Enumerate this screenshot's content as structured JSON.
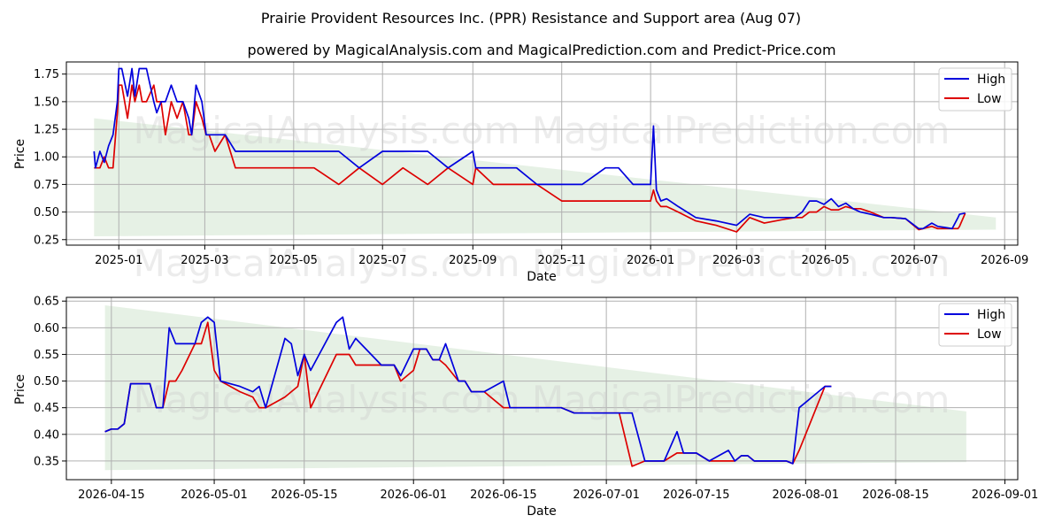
{
  "title": "Prairie Provident Resources Inc. (PPR) Resistance and Support area (Aug 07)",
  "subtitle": "powered by MagicalAnalysis.com and MagicalPrediction.com and Predict-Price.com",
  "watermark": "MagicalAnalysis.com    MagicalPrediction.com",
  "colors": {
    "high": "#0000dd",
    "low": "#dd0000",
    "band": "#e2efe0",
    "grid": "#b0b0b0"
  },
  "chart_data": [
    {
      "type": "line",
      "xlabel": "Date",
      "ylabel": "Price",
      "grid": true,
      "legend_position": "top-right",
      "xlim": [
        "2024-11-26",
        "2026-09-10"
      ],
      "ylim": [
        0.2,
        1.86
      ],
      "xticks": [
        "2025-01",
        "2025-03",
        "2025-05",
        "2025-07",
        "2025-09",
        "2025-11",
        "2026-01",
        "2026-03",
        "2026-05",
        "2026-07",
        "2026-09"
      ],
      "yticks": [
        "0.25",
        "0.50",
        "0.75",
        "1.00",
        "1.25",
        "1.50",
        "1.75"
      ],
      "band": {
        "label": "Resistance and Support area",
        "x": [
          "2024-12-15",
          "2026-08-26"
        ],
        "upper": [
          1.35,
          0.45
        ],
        "lower": [
          0.28,
          0.34
        ]
      },
      "series": [
        {
          "name": "High",
          "x": [
            "2024-12-15",
            "2024-12-16",
            "2024-12-19",
            "2024-12-22",
            "2024-12-25",
            "2024-12-28",
            "2024-12-31",
            "2025-01-01",
            "2025-01-03",
            "2025-01-07",
            "2025-01-10",
            "2025-01-12",
            "2025-01-15",
            "2025-01-17",
            "2025-01-20",
            "2025-01-25",
            "2025-01-27",
            "2025-01-30",
            "2025-02-02",
            "2025-02-06",
            "2025-02-10",
            "2025-02-14",
            "2025-02-18",
            "2025-02-20",
            "2025-02-23",
            "2025-02-27",
            "2025-03-02",
            "2025-03-04",
            "2025-03-08",
            "2025-03-15",
            "2025-03-22",
            "2025-03-27",
            "2025-04-01",
            "2025-04-15",
            "2025-05-01",
            "2025-05-10",
            "2025-05-15",
            "2025-06-01",
            "2025-06-15",
            "2025-07-01",
            "2025-07-15",
            "2025-08-01",
            "2025-08-15",
            "2025-09-01",
            "2025-09-03",
            "2025-09-15",
            "2025-10-01",
            "2025-10-15",
            "2025-11-01",
            "2025-11-15",
            "2025-12-01",
            "2025-12-10",
            "2025-12-20",
            "2026-01-01",
            "2026-01-03",
            "2026-01-05",
            "2026-01-08",
            "2026-01-12",
            "2026-01-20",
            "2026-02-01",
            "2026-02-15",
            "2026-03-01",
            "2026-03-10",
            "2026-03-20",
            "2026-04-01",
            "2026-04-10",
            "2026-04-15",
            "2026-04-20",
            "2026-04-25",
            "2026-04-30",
            "2026-05-05",
            "2026-05-10",
            "2026-05-15",
            "2026-05-20",
            "2026-05-25",
            "2026-06-01",
            "2026-06-10",
            "2026-06-15",
            "2026-06-25",
            "2026-07-04",
            "2026-07-07",
            "2026-07-13",
            "2026-07-17",
            "2026-07-22",
            "2026-07-27",
            "2026-07-31",
            "2026-08-01",
            "2026-08-05"
          ],
          "values": [
            1.05,
            0.9,
            1.05,
            0.95,
            1.1,
            1.2,
            1.5,
            1.8,
            1.8,
            1.55,
            1.8,
            1.55,
            1.8,
            1.8,
            1.8,
            1.5,
            1.4,
            1.5,
            1.5,
            1.65,
            1.5,
            1.5,
            1.35,
            1.2,
            1.65,
            1.5,
            1.2,
            1.2,
            1.2,
            1.2,
            1.05,
            1.05,
            1.05,
            1.05,
            1.05,
            1.05,
            1.05,
            1.05,
            0.9,
            1.05,
            1.05,
            1.05,
            0.9,
            1.05,
            0.9,
            0.9,
            0.9,
            0.75,
            0.75,
            0.75,
            0.9,
            0.9,
            0.75,
            0.75,
            1.28,
            0.7,
            0.6,
            0.62,
            0.55,
            0.45,
            0.42,
            0.38,
            0.48,
            0.45,
            0.45,
            0.45,
            0.5,
            0.6,
            0.6,
            0.57,
            0.62,
            0.55,
            0.58,
            0.53,
            0.5,
            0.48,
            0.45,
            0.45,
            0.44,
            0.35,
            0.35,
            0.4,
            0.37,
            0.36,
            0.35,
            0.45,
            0.48,
            0.49
          ]
        },
        {
          "name": "Low",
          "x": [
            "2024-12-15",
            "2024-12-19",
            "2024-12-22",
            "2024-12-25",
            "2024-12-28",
            "2024-12-31",
            "2025-01-01",
            "2025-01-03",
            "2025-01-07",
            "2025-01-10",
            "2025-01-12",
            "2025-01-15",
            "2025-01-17",
            "2025-01-20",
            "2025-01-25",
            "2025-01-27",
            "2025-01-30",
            "2025-02-02",
            "2025-02-06",
            "2025-02-10",
            "2025-02-14",
            "2025-02-18",
            "2025-02-20",
            "2025-02-23",
            "2025-02-27",
            "2025-03-02",
            "2025-03-04",
            "2025-03-08",
            "2025-03-15",
            "2025-03-22",
            "2025-03-27",
            "2025-04-01",
            "2025-04-15",
            "2025-05-01",
            "2025-05-10",
            "2025-05-15",
            "2025-06-01",
            "2025-06-15",
            "2025-07-01",
            "2025-07-15",
            "2025-08-01",
            "2025-08-15",
            "2025-09-01",
            "2025-09-03",
            "2025-09-15",
            "2025-10-01",
            "2025-10-15",
            "2025-11-01",
            "2025-11-15",
            "2025-12-01",
            "2025-12-10",
            "2025-12-20",
            "2026-01-01",
            "2026-01-03",
            "2026-01-05",
            "2026-01-08",
            "2026-01-12",
            "2026-01-20",
            "2026-02-01",
            "2026-02-15",
            "2026-03-01",
            "2026-03-10",
            "2026-03-20",
            "2026-04-01",
            "2026-04-10",
            "2026-04-15",
            "2026-04-20",
            "2026-04-25",
            "2026-04-30",
            "2026-05-05",
            "2026-05-10",
            "2026-05-15",
            "2026-05-20",
            "2026-05-25",
            "2026-06-01",
            "2026-06-10",
            "2026-06-15",
            "2026-06-25",
            "2026-07-04",
            "2026-07-07",
            "2026-07-13",
            "2026-07-17",
            "2026-07-22",
            "2026-07-27",
            "2026-07-31",
            "2026-08-01",
            "2026-08-05"
          ],
          "values": [
            0.9,
            0.9,
            1.0,
            0.9,
            0.9,
            1.4,
            1.65,
            1.65,
            1.35,
            1.65,
            1.5,
            1.65,
            1.5,
            1.5,
            1.65,
            1.5,
            1.5,
            1.2,
            1.5,
            1.35,
            1.5,
            1.2,
            1.2,
            1.5,
            1.35,
            1.2,
            1.2,
            1.05,
            1.2,
            0.9,
            0.9,
            0.9,
            0.9,
            0.9,
            0.9,
            0.9,
            0.75,
            0.9,
            0.75,
            0.9,
            0.75,
            0.9,
            0.75,
            0.9,
            0.75,
            0.75,
            0.75,
            0.6,
            0.6,
            0.6,
            0.6,
            0.6,
            0.6,
            0.7,
            0.6,
            0.55,
            0.55,
            0.5,
            0.42,
            0.38,
            0.32,
            0.45,
            0.4,
            0.43,
            0.45,
            0.45,
            0.5,
            0.5,
            0.55,
            0.52,
            0.52,
            0.55,
            0.53,
            0.53,
            0.5,
            0.45,
            0.45,
            0.44,
            0.34,
            0.35,
            0.37,
            0.35,
            0.35,
            0.35,
            0.35,
            0.37,
            0.49
          ]
        }
      ]
    },
    {
      "type": "line",
      "xlabel": "Date",
      "ylabel": "Price",
      "grid": true,
      "legend_position": "top-right",
      "xlim": [
        "2026-04-08",
        "2026-09-03"
      ],
      "ylim": [
        0.315,
        0.657
      ],
      "xticks": [
        "2026-04-15",
        "2026-05-01",
        "2026-05-15",
        "2026-06-01",
        "2026-06-15",
        "2026-07-01",
        "2026-07-15",
        "2026-08-01",
        "2026-08-15",
        "2026-09-01"
      ],
      "yticks": [
        "0.35",
        "0.40",
        "0.45",
        "0.50",
        "0.55",
        "0.60",
        "0.65"
      ],
      "band": {
        "label": "Resistance and Support area",
        "x": [
          "2026-04-14",
          "2026-08-26"
        ],
        "upper": [
          0.642,
          0.443
        ],
        "lower": [
          0.333,
          0.348
        ]
      },
      "series": [
        {
          "name": "High",
          "x": [
            "2026-04-14",
            "2026-04-15",
            "2026-04-16",
            "2026-04-17",
            "2026-04-18",
            "2026-04-20",
            "2026-04-21",
            "2026-04-22",
            "2026-04-23",
            "2026-04-24",
            "2026-04-25",
            "2026-04-26",
            "2026-04-28",
            "2026-04-29",
            "2026-04-30",
            "2026-05-01",
            "2026-05-02",
            "2026-05-05",
            "2026-05-07",
            "2026-05-08",
            "2026-05-09",
            "2026-05-12",
            "2026-05-13",
            "2026-05-14",
            "2026-05-15",
            "2026-05-16",
            "2026-05-20",
            "2026-05-21",
            "2026-05-22",
            "2026-05-23",
            "2026-05-27",
            "2026-05-29",
            "2026-05-30",
            "2026-06-01",
            "2026-06-02",
            "2026-06-03",
            "2026-06-04",
            "2026-06-05",
            "2026-06-06",
            "2026-06-08",
            "2026-06-09",
            "2026-06-10",
            "2026-06-12",
            "2026-06-15",
            "2026-06-16",
            "2026-06-24",
            "2026-06-26",
            "2026-07-01",
            "2026-07-03",
            "2026-07-05",
            "2026-07-07",
            "2026-07-10",
            "2026-07-12",
            "2026-07-13",
            "2026-07-15",
            "2026-07-17",
            "2026-07-20",
            "2026-07-21",
            "2026-07-22",
            "2026-07-23",
            "2026-07-24",
            "2026-07-27",
            "2026-07-28",
            "2026-07-29",
            "2026-07-30",
            "2026-07-31",
            "2026-08-01",
            "2026-08-02",
            "2026-08-03",
            "2026-08-04",
            "2026-08-05"
          ],
          "values": [
            0.405,
            0.41,
            0.41,
            0.42,
            0.495,
            0.495,
            0.495,
            0.45,
            0.45,
            0.6,
            0.57,
            0.57,
            0.57,
            0.61,
            0.62,
            0.61,
            0.5,
            0.49,
            0.48,
            0.49,
            0.45,
            0.58,
            0.57,
            0.51,
            0.55,
            0.52,
            0.61,
            0.62,
            0.56,
            0.58,
            0.53,
            0.53,
            0.51,
            0.56,
            0.56,
            0.56,
            0.54,
            0.54,
            0.57,
            0.5,
            0.5,
            0.48,
            0.48,
            0.5,
            0.45,
            0.45,
            0.44,
            0.44,
            0.44,
            0.44,
            0.35,
            0.35,
            0.405,
            0.365,
            0.365,
            0.35,
            0.37,
            0.35,
            0.36,
            0.36,
            0.35,
            0.35,
            0.35,
            0.35,
            0.345,
            0.45,
            0.46,
            0.47,
            0.48,
            0.49,
            0.49
          ]
        },
        {
          "name": "Low",
          "x": [
            "2026-04-14",
            "2026-04-15",
            "2026-04-16",
            "2026-04-17",
            "2026-04-18",
            "2026-04-20",
            "2026-04-21",
            "2026-04-22",
            "2026-04-23",
            "2026-04-24",
            "2026-04-25",
            "2026-04-26",
            "2026-04-28",
            "2026-04-29",
            "2026-04-30",
            "2026-05-01",
            "2026-05-02",
            "2026-05-05",
            "2026-05-07",
            "2026-05-08",
            "2026-05-09",
            "2026-05-12",
            "2026-05-13",
            "2026-05-14",
            "2026-05-15",
            "2026-05-16",
            "2026-05-20",
            "2026-05-21",
            "2026-05-22",
            "2026-05-23",
            "2026-05-27",
            "2026-05-29",
            "2026-05-30",
            "2026-06-01",
            "2026-06-02",
            "2026-06-03",
            "2026-06-04",
            "2026-06-05",
            "2026-06-06",
            "2026-06-08",
            "2026-06-09",
            "2026-06-10",
            "2026-06-12",
            "2026-06-15",
            "2026-06-16",
            "2026-06-24",
            "2026-06-26",
            "2026-07-01",
            "2026-07-03",
            "2026-07-05",
            "2026-07-07",
            "2026-07-10",
            "2026-07-12",
            "2026-07-13",
            "2026-07-15",
            "2026-07-17",
            "2026-07-20",
            "2026-07-21",
            "2026-07-22",
            "2026-07-23",
            "2026-07-24",
            "2026-07-27",
            "2026-07-28",
            "2026-07-29",
            "2026-07-30",
            "2026-07-31",
            "2026-08-01",
            "2026-08-02",
            "2026-08-03",
            "2026-08-04",
            "2026-08-05"
          ],
          "values": [
            0.405,
            0.41,
            0.41,
            0.42,
            0.495,
            0.495,
            0.495,
            0.45,
            0.45,
            0.5,
            0.5,
            0.52,
            0.57,
            0.57,
            0.61,
            0.52,
            0.5,
            0.48,
            0.47,
            0.45,
            0.45,
            0.47,
            0.48,
            0.49,
            0.55,
            0.45,
            0.55,
            0.55,
            0.55,
            0.53,
            0.53,
            0.53,
            0.5,
            0.52,
            0.56,
            0.56,
            0.54,
            0.54,
            0.53,
            0.5,
            0.5,
            0.48,
            0.48,
            0.45,
            0.45,
            0.45,
            0.44,
            0.44,
            0.44,
            0.34,
            0.35,
            0.35,
            0.365,
            0.365,
            0.365,
            0.35,
            0.35,
            0.35,
            0.36,
            0.36,
            0.35,
            0.35,
            0.35,
            0.35,
            0.345,
            0.37,
            0.4,
            0.43,
            0.46,
            0.49,
            0.49
          ]
        }
      ]
    }
  ]
}
